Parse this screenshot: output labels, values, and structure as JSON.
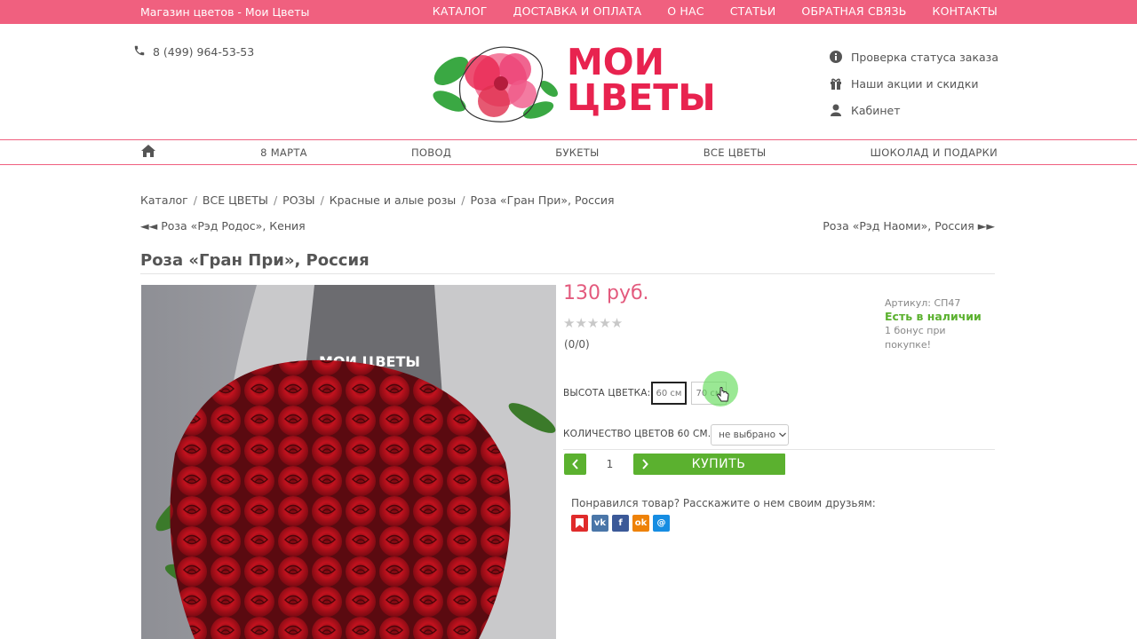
{
  "topbar": {
    "shop_name": "Магазин цветов - Мои Цветы",
    "menu": [
      "КАТАЛОГ",
      "ДОСТАВКА И ОПЛАТА",
      "О НАС",
      "СТАТЬИ",
      "ОБРАТНАЯ СВЯЗЬ",
      "КОНТАКТЫ"
    ],
    "color": "#f0607f"
  },
  "header": {
    "phone": "8 (499) 964-53-53",
    "logo_line1": "МОИ",
    "logo_line2": "ЦВЕТЫ",
    "side_links": [
      {
        "icon": "info-circle-icon",
        "label": "Проверка статуса заказа"
      },
      {
        "icon": "gift-icon",
        "label": "Наши акции и скидки"
      },
      {
        "icon": "user-icon",
        "label": "Кабинет"
      }
    ]
  },
  "nav": {
    "home_icon": "home-icon",
    "items": [
      "8 МАРТА",
      "ПОВОД",
      "БУКЕТЫ",
      "ВСЕ ЦВЕТЫ",
      "ШОКОЛАД И ПОДАРКИ"
    ]
  },
  "breadcrumbs": [
    "Каталог",
    "ВСЕ ЦВЕТЫ",
    "РОЗЫ",
    "Красные и алые розы",
    "Роза «Гран При», Россия"
  ],
  "prev_product": "◄◄ Роза «Рэд Родос», Кения",
  "next_product": "Роза «Рэд Наоми», Россия ►►",
  "product": {
    "title": "Роза «Гран При», Россия",
    "photo_text": "МОИ ЦВЕТЫ",
    "price": "130 руб.",
    "stars": "★★★★★",
    "votes": "(0/0)",
    "sku": "Артикул: СП47",
    "stock": "Есть в наличии",
    "bonus": "1 бонус при покупке!",
    "height_label": "ВЫСОТА ЦВЕТКА:",
    "heights": [
      "60 см",
      "70 см"
    ],
    "selected_height": "60 см",
    "qty_label": "КОЛИЧЕСТВО ЦВЕТОВ 60 СМ.:",
    "qty_select": "не выбрано",
    "quantity": "1",
    "buy_label": "КУПИТЬ",
    "share_text": "Понравился товар? Расскажите о нем своим друзьям:",
    "share": [
      {
        "icon": "bookmark-icon",
        "color": "#e02b2b",
        "glyph": "▮"
      },
      {
        "icon": "vk-icon",
        "color": "#4a76a8",
        "glyph": "vk"
      },
      {
        "icon": "facebook-icon",
        "color": "#3b5998",
        "glyph": "f"
      },
      {
        "icon": "odnoklassniki-icon",
        "color": "#ee8208",
        "glyph": "ok"
      },
      {
        "icon": "moimir-icon",
        "color": "#168de2",
        "glyph": "@"
      }
    ],
    "accent": "#5bb12f",
    "price_color": "#e35a7d"
  }
}
